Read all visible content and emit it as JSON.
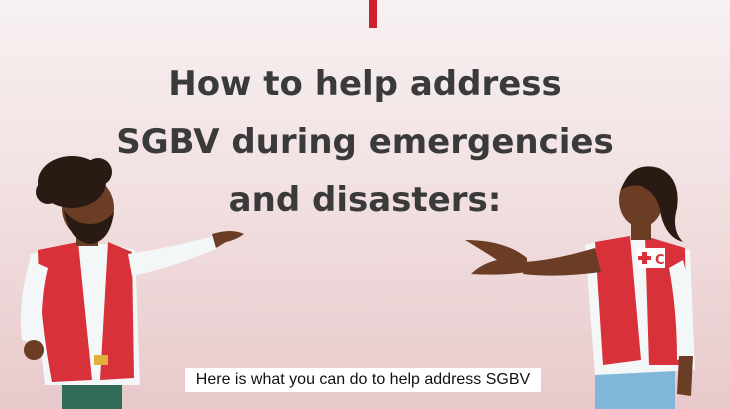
{
  "title": {
    "line1": "How to help address",
    "line2": "SGBV during emergencies",
    "line3": "and disasters:"
  },
  "caption": "Here is what you can do to help address SGBV",
  "badge": {
    "text": "C"
  },
  "colors": {
    "accent_red": "#d0202a",
    "vest_red": "#d8313a",
    "skin_dark": "#6b3d25",
    "text_dark": "#3a3a3a"
  }
}
